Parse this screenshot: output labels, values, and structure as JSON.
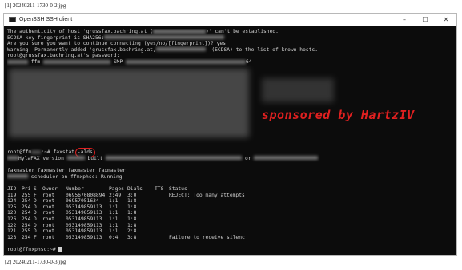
{
  "captions": {
    "top": "[1] 20240211-1730-0-2.jpg",
    "bottom": "[2] 20240211-1730-0-3.jpg"
  },
  "window": {
    "title": "OpenSSH SSH client",
    "controls": {
      "minimize": "–",
      "maximize": "☐",
      "close": "✕"
    },
    "icon": "terminal-icon"
  },
  "terminal": {
    "lines": {
      "l1a": "The authenticity of host 'grussfax.bachring.at (",
      "l1b": ")' can't be established.",
      "l2a": "ECDSA key fingerprint is SHA256:",
      "l3": "Are you sure you want to continue connecting (yes/no/[fingerprint])? yes",
      "l4a": "Warning: Permanently added 'grussfax.bachring.at,",
      "l4b": "' (ECDSA) to the list of known hosts.",
      "l5": "root@grussfax.bachring.at's password:",
      "l6a": "ffm",
      "l6b": "SMP",
      "l6c": "64"
    },
    "cmd": {
      "prompt": "root@ffm",
      "path": ":~# ",
      "command": "faxstat ",
      "flag": "-alds"
    },
    "hylafax": {
      "a": "HylaFAX version",
      "b": "built",
      "c": "or"
    },
    "modems": {
      "names": "faxmaster faxmaster faxmaster faxmaster",
      "scheduler": "scheduler on ffmxphsc: Running"
    },
    "table": {
      "headers": [
        "JID",
        "Pri",
        "S",
        "Owner",
        "Number",
        "Pages",
        "Dials",
        "TTS",
        "Status"
      ],
      "rows": [
        {
          "jid": "119",
          "pri": "255",
          "s": "F",
          "owner": "root",
          "number": "0695670808894",
          "pages": "2:49",
          "dials": "3:0",
          "tts": "",
          "status": "REJECT: Too many attempts"
        },
        {
          "jid": "124",
          "pri": "254",
          "s": "D",
          "owner": "root",
          "number": "06957051634",
          "pages": "1:1",
          "dials": "1:8",
          "tts": "",
          "status": ""
        },
        {
          "jid": "125",
          "pri": "254",
          "s": "D",
          "owner": "root",
          "number": "053149859113",
          "pages": "1:1",
          "dials": "1:8",
          "tts": "",
          "status": ""
        },
        {
          "jid": "120",
          "pri": "254",
          "s": "D",
          "owner": "root",
          "number": "053149859113",
          "pages": "1:1",
          "dials": "1:8",
          "tts": "",
          "status": ""
        },
        {
          "jid": "126",
          "pri": "254",
          "s": "D",
          "owner": "root",
          "number": "053149859113",
          "pages": "1:1",
          "dials": "1:8",
          "tts": "",
          "status": ""
        },
        {
          "jid": "122",
          "pri": "254",
          "s": "D",
          "owner": "root",
          "number": "053149859113",
          "pages": "1:1",
          "dials": "1:8",
          "tts": "",
          "status": ""
        },
        {
          "jid": "121",
          "pri": "255",
          "s": "D",
          "owner": "root",
          "number": "053149859113",
          "pages": "1:1",
          "dials": "2:8",
          "tts": "",
          "status": ""
        },
        {
          "jid": "123",
          "pri": "254",
          "s": "F",
          "owner": "root",
          "number": "053149859113",
          "pages": "0:4",
          "dials": "3:8",
          "tts": "",
          "status": "Failure to receive silenc"
        }
      ]
    },
    "final_prompt": "root@ffmxphsc:~# "
  },
  "overlay": {
    "sponsor_text": "sponsored by HartzIV",
    "color": "#e02020"
  },
  "colors": {
    "terminal_bg": "#0c0c0c",
    "terminal_fg": "#d2d2d2",
    "titlebar_bg": "#ffffff"
  }
}
